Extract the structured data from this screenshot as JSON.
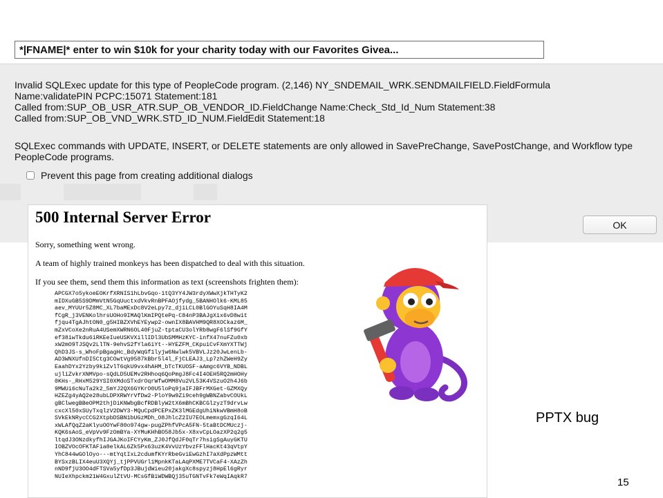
{
  "email": {
    "subject": "*|FNAME|* enter to win $10k for your charity today with our Favorites Givea..."
  },
  "dialog": {
    "message_lines": [
      "Invalid SQLExec update for this type of PeopleCode program. (2,146) NY_SNDEMAIL_WRK.SENDMAILFIELD.FieldFormula",
      "Name:validatePIN  PCPC:15071  Statement:181",
      "Called from:SUP_OB_USR_ATR.SUP_OB_VENDOR_ID.FieldChange  Name:Check_Std_Id_Num  Statement:38",
      "Called from:SUP_OB_VND_WRK.STD_ID_NUM.FieldEdit  Statement:18"
    ],
    "message2": "SQLExec commands with UPDATE, INSERT, or DELETE statements are only allowed in SavePreChange, SavePostChange, and Workflow type PeopleCode programs.",
    "prevent_label": "Prevent this page from creating additional dialogs",
    "prevent_checked": false,
    "ok_label": "OK"
  },
  "error_page": {
    "title": "500 Internal Server Error",
    "line1": "Sorry, something went wrong.",
    "line2": "A team of highly trained monkeys has been dispatched to deal with this situation.",
    "line3": "If you see them, send them this information as text (screenshots frighten them):",
    "code_lines": [
      "APCGX7o5ykoeEOKrfXRNIS1hLbvGqo-1tQ3YY4JW3rdyXWwXjkTHTyK2",
      "mIDXuGB5S9DMmVtN5GqUuctxdVkvRnBPFAOjfydg_5BANHOlk6-KML85",
      "aev_MYUUr5Z8MC_XL7baMExDc8V2eLpy7z_djiLCL0BlGOYuSqH8IA4M",
      "fCgR_j3VENKolhrsUOHo9IMAQlKmIPQtePq-C84nP3BAJgXix6vD8wit",
      "fjqu4TgAJhtON0_g5HIBZXVhEYEywp2-ownIX8BAVHM9QR8XOCkaz6M_",
      "mZxVCoXe2nRuA4USemXWRN6OL40FjuZ-tptaCU3olYRb8wgF6lSf9GfY",
      "ef38iwTkdu6iRKEeIueUSKVXillIDl3UbSMMHzKYC-infX47nuFZu0xb",
      "xW2mO9TJSQv2LlTN-9ehvS2fYla6iYt--HYEZFM_CKpuiCvFXmYXTTWj",
      "QhD3JS-s_WhoFpBgagHc_BdyWqGf1lyjw6Nwlwk5VBVLJz20JwLenLb-",
      "AD3WNXUfnDI5Ctg3COwtVg9587kBbr5l4l_FjCLEAJ3_Lp7zhZWeH9Zy",
      "EaahDYx2Yzby9kiZvlT6qkU9vx4hAHM_bTcTKUOSF-aAmgc6VYB_NDBL",
      "ujliZvkrXNMVpo-sQdLD5UEMv2RHhoq6QoPmgJ8Fc4I4OEH5RQ2mHOHy",
      "0KHs-_RHxM529YSI0XMdoSTxdrOqrWfwOMM8Vu2VL53K4VSzuO2h4J6b",
      "9MWUi6cNuTa2k2_5mYJ2QX6GYKrO0U5loPq9jaIFJBFrMXGet-GZMXQy",
      "HZEZg4yAQ2e28ubLDPXRWYrVfDw2-PloY9w9Zi9ceh9gWBNZabvCOUkL",
      "gBClwegBBeOPM2thjDiKNWbgBcfRDBlyW2tX6mBhCKBCGlzyzT9drvLw",
      "cxcXl50xSUyTxqlzV2DWY3-MQuCpdPCEPxZK3lMGEdgUhiNkwVBmH8oB",
      "SVkEkNRycCCG2XtpbDSBN1bUGzMDh_O8JhlcZ2IU7EOLmemxgGzqI64L",
      "xWLAfQqZ2aKlyuOOYwF80o974gw-pugZPhfVPcA5FN-5taBtDCMUczj-",
      "KQK6sAoS_eVpVv9FzOmBYa-XYMuKHhBO58Jb5x-X8xvCpLOazXP2q2g5",
      "ltqdJ3ONzdkyfhIJGAJKoIFCYyKm_ZJ0JfQdJF0qTr7hsigSgAuyGKTU",
      "IOBZVOcOFKTAFia8elkAL6Zk5Px63uzK4VvUzYbvzFFlHacKt43qVtpY",
      "YhC844wGOlOyo---mtYqtIxL2cdumfKYrRbeGviEwGzhI7aXdPpzWMtt",
      "BYSxzBLIX4euU3XQYj_tjPPVUGrl1MpnkKTaLAqPXME7TVCaF4-XAzZh",
      "nND9fjU3OO4dFTSVa5yfDp3JBujdWieu20jakgXc8spyzj8HpEl6gRyr",
      "NUIeXhpckm21W4GxulZtVU-MCsGfBiWDWBQj35uTGNTvFk7eWqIAqkR7"
    ]
  },
  "slide": {
    "annotation": "PPTX bug",
    "page_number": "15"
  }
}
